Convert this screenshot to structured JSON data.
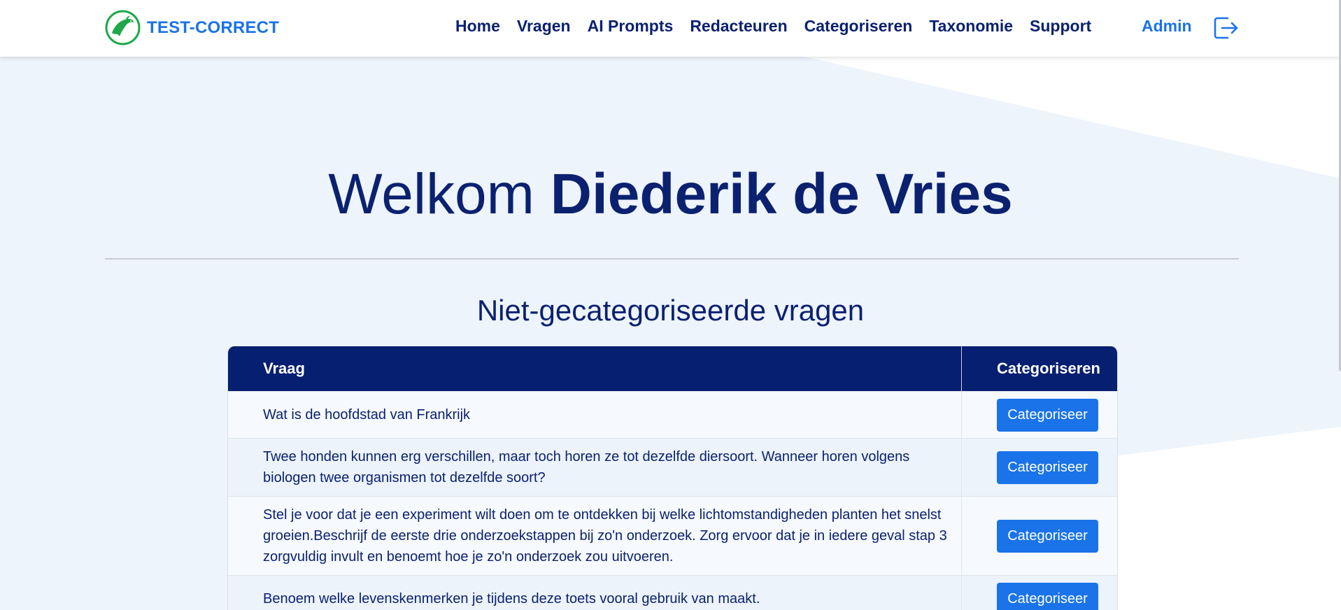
{
  "brand": {
    "name": "TEST-CORRECT",
    "logo_icon": "dolphin-logo-icon",
    "color": "#1a73e8",
    "logo_color": "#1ea84a"
  },
  "nav": {
    "items": [
      {
        "label": "Home"
      },
      {
        "label": "Vragen"
      },
      {
        "label": "AI Prompts"
      },
      {
        "label": "Redacteuren"
      },
      {
        "label": "Categoriseren"
      },
      {
        "label": "Taxonomie"
      },
      {
        "label": "Support"
      }
    ],
    "admin_label": "Admin",
    "logout_icon": "logout-icon"
  },
  "welcome": {
    "prefix": "Welkom",
    "name": "Diederik de Vries"
  },
  "section": {
    "title": "Niet-gecategoriseerde vragen"
  },
  "table": {
    "headers": {
      "question": "Vraag",
      "action": "Categoriseren"
    },
    "rows": [
      {
        "question": "Wat is de hoofdstad van Frankrijk",
        "button": "Categoriseer"
      },
      {
        "question": "Twee honden kunnen erg verschillen, maar toch horen ze tot dezelfde diersoort. Wanneer horen volgens biologen twee organismen tot dezelfde soort?",
        "button": "Categoriseer"
      },
      {
        "question": "Stel je voor dat je een experiment wilt doen om te ontdekken bij welke lichtomstandigheden planten het snelst groeien.Beschrijf de eerste drie onderzoekstappen bij zo'n onderzoek. Zorg ervoor dat je in iedere geval stap 3 zorgvuldig invult en benoemt hoe je zo'n onderzoek zou uitvoeren.",
        "button": "Categoriseer"
      },
      {
        "question": "Benoem welke levenskenmerken je tijdens deze toets vooral gebruik van maakt.",
        "button": "Categoriseer"
      }
    ]
  },
  "colors": {
    "navy": "#0b2170",
    "header_bg": "#061f70",
    "button": "#1a73e8",
    "page_bg": "#eef4fc"
  }
}
